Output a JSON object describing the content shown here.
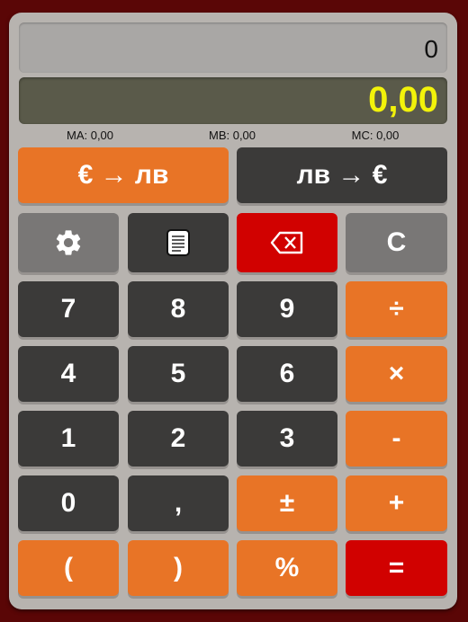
{
  "display": {
    "expression": "0",
    "result": "0,00"
  },
  "memory": {
    "ma": "MA: 0,00",
    "mb": "MB: 0,00",
    "mc": "MC: 0,00"
  },
  "convert": {
    "eur_to_bgn": "€ → лв",
    "bgn_to_eur": "лв → €"
  },
  "keys": {
    "clear": "C",
    "seven": "7",
    "eight": "8",
    "nine": "9",
    "divide": "÷",
    "four": "4",
    "five": "5",
    "six": "6",
    "multiply": "×",
    "one": "1",
    "two": "2",
    "three": "3",
    "minus": "-",
    "zero": "0",
    "comma": ",",
    "plusminus": "±",
    "plus": "+",
    "lparen": "(",
    "rparen": ")",
    "percent": "%",
    "equals": "="
  },
  "icons": {
    "settings": "gear-icon",
    "history": "notepad-icon",
    "backspace": "backspace-icon"
  },
  "colors": {
    "orange": "#e87426",
    "dark": "#3b3a39",
    "red": "#d10100",
    "grey": "#797776",
    "result_text": "#f2f20a"
  }
}
